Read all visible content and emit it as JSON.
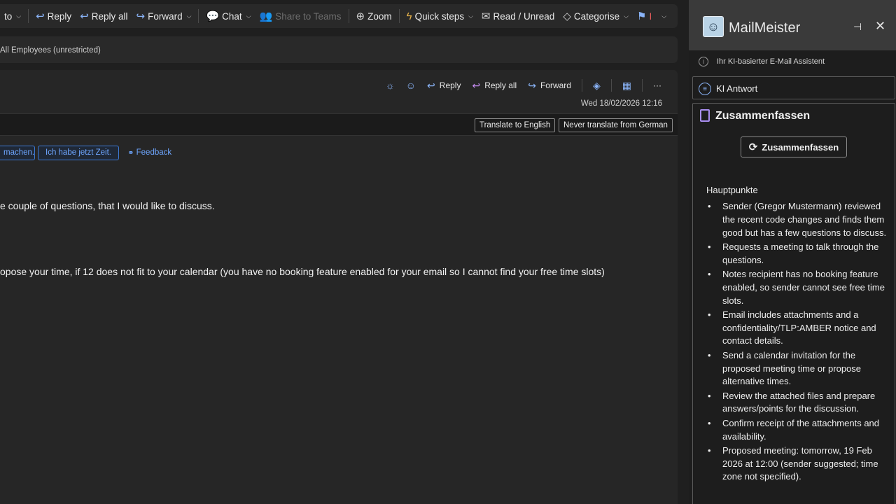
{
  "ribbon": {
    "items": [
      {
        "label": "to",
        "icon": "chevron-down-icon"
      },
      {
        "label": "Reply",
        "icon": "reply-icon"
      },
      {
        "label": "Reply all",
        "icon": "reply-all-icon"
      },
      {
        "label": "Forward",
        "icon": "forward-icon"
      },
      {
        "label": "Chat",
        "icon": "chat-icon"
      },
      {
        "label": "Share to Teams",
        "icon": "teams-icon",
        "disabled": true
      },
      {
        "label": "Zoom",
        "icon": "zoom-icon"
      },
      {
        "label": "Quick steps",
        "icon": "lightning-icon"
      },
      {
        "label": "Read / Unread",
        "icon": "envelope-open-icon"
      },
      {
        "label": "Categorise",
        "icon": "tag-icon"
      },
      {
        "label": "I",
        "icon": "flag-icon"
      }
    ]
  },
  "sensitivity": {
    "label": "All Employees (unrestricted)"
  },
  "message": {
    "actions": {
      "reply": "Reply",
      "reply_all": "Reply all",
      "forward": "Forward"
    },
    "date": "Wed 18/02/2026 12:16",
    "translate": {
      "to_english": "Translate to English",
      "never": "Never translate from German"
    },
    "suggestions": [
      "machen.",
      "Ich habe jetzt Zeit."
    ],
    "feedback": "Feedback",
    "body_lines": [
      "e couple of questions, that I would like to discuss.",
      "opose your time, if 12 does not fit to your calendar (you have no booking feature enabled for your email so I cannot find your free time slots)"
    ]
  },
  "panel": {
    "title": "MailMeister",
    "subtitle": "Ihr KI-basierter E-Mail Assistent",
    "ki_antwort": "KI Antwort",
    "summarize": {
      "heading": "Zusammenfassen",
      "button": "Zusammenfassen",
      "main_points_label": "Hauptpunkte",
      "points": [
        "Sender (Gregor Mustermann) reviewed the recent code changes and finds them good but has a few questions to discuss.",
        "Requests a meeting to talk through the questions.",
        "Notes recipient has no booking feature enabled, so sender cannot see free time slots.",
        "Email includes attachments and a confidentiality/TLP:AMBER notice and contact details.",
        "Send a calendar invitation for the proposed meeting time or propose alternative times.",
        "Review the attached files and prepare answers/points for the discussion.",
        "Confirm receipt of the attachments and availability.",
        "Proposed meeting: tomorrow, 19 Feb 2026 at 12:00 (sender suggested; time zone not specified)."
      ]
    }
  },
  "colors": {
    "accent": "#8ab4f8",
    "link": "#6ea6ff",
    "flag": "#e25b5b",
    "panel_header": "#3a3a3a"
  }
}
